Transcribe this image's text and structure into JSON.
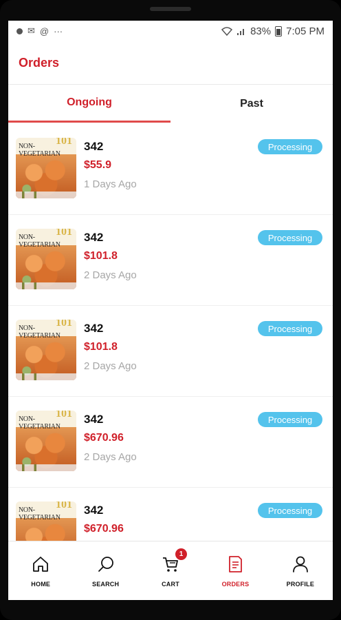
{
  "status_bar": {
    "battery": "83%",
    "time": "7:05 PM",
    "more": "···"
  },
  "header": {
    "title": "Orders"
  },
  "tabs": [
    {
      "label": "Ongoing",
      "active": true
    },
    {
      "label": "Past",
      "active": false
    }
  ],
  "thumbnail": {
    "caption": "NON-VEGETARIAN",
    "number": "101"
  },
  "orders": [
    {
      "id": "342",
      "price": "$55.9",
      "ago": "1 Days Ago",
      "status": "Processing"
    },
    {
      "id": "342",
      "price": "$101.8",
      "ago": "2 Days Ago",
      "status": "Processing"
    },
    {
      "id": "342",
      "price": "$101.8",
      "ago": "2 Days Ago",
      "status": "Processing"
    },
    {
      "id": "342",
      "price": "$670.96",
      "ago": "2 Days Ago",
      "status": "Processing"
    },
    {
      "id": "342",
      "price": "$670.96",
      "ago": "",
      "status": "Processing"
    }
  ],
  "bottom_nav": {
    "items": [
      {
        "label": "HOME",
        "icon": "home-icon"
      },
      {
        "label": "SEARCH",
        "icon": "search-icon"
      },
      {
        "label": "CART",
        "icon": "cart-icon",
        "badge": "1"
      },
      {
        "label": "ORDERS",
        "icon": "orders-icon",
        "active": true
      },
      {
        "label": "PROFILE",
        "icon": "profile-icon"
      }
    ]
  },
  "colors": {
    "accent": "#d0202a",
    "status_badge": "#54c3ec",
    "muted_text": "#a6a6a6"
  }
}
